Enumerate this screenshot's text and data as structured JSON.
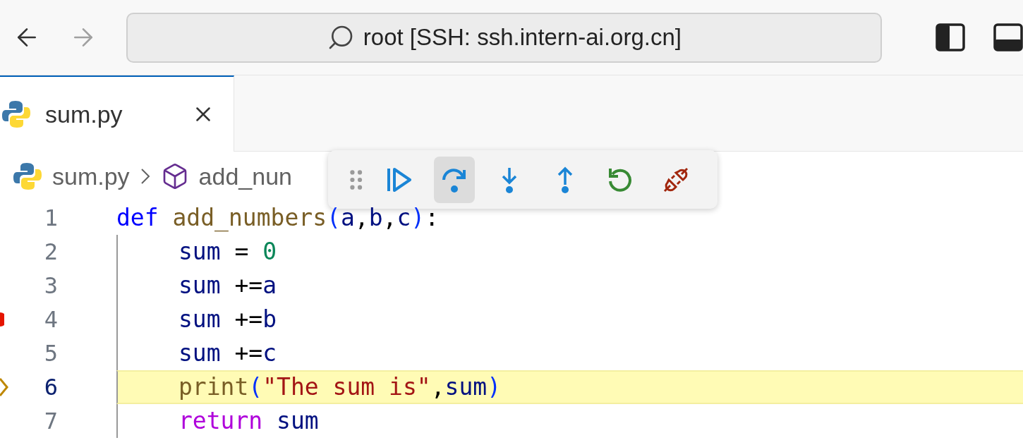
{
  "title_bar": {
    "nav": [
      {
        "kind": "back",
        "disabled": false
      },
      {
        "kind": "forward",
        "disabled": true
      }
    ],
    "command_center": "root [SSH: ssh.intern-ai.org.cn]"
  },
  "tabs": [
    {
      "label": "sum.py",
      "selected": true
    }
  ],
  "breadcrumb": [
    {
      "kind": "file",
      "label": "sum.py"
    },
    {
      "kind": "symbol",
      "label": "add_nun"
    }
  ],
  "debug_toolbar": [
    {
      "kind": "continue",
      "selected": false
    },
    {
      "kind": "step_over",
      "selected": true
    },
    {
      "kind": "step_into",
      "selected": false
    },
    {
      "kind": "step_out",
      "selected": false
    },
    {
      "kind": "restart",
      "selected": false
    },
    {
      "kind": "disconnect",
      "selected": false
    }
  ],
  "code": [
    {
      "number": "1",
      "breakpoint": false,
      "current": false,
      "indented": false,
      "tokens": [
        {
          "kind": "keyword",
          "text": "def "
        },
        {
          "kind": "function",
          "text": "add_numbers"
        },
        {
          "kind": "bracket",
          "text": "("
        },
        {
          "kind": "variable",
          "text": "a"
        },
        {
          "kind": "plain",
          "text": ","
        },
        {
          "kind": "variable",
          "text": "b"
        },
        {
          "kind": "plain",
          "text": ","
        },
        {
          "kind": "variable",
          "text": "c"
        },
        {
          "kind": "bracket",
          "text": ")"
        },
        {
          "kind": "plain",
          "text": ":"
        }
      ]
    },
    {
      "number": "2",
      "breakpoint": false,
      "current": false,
      "indented": true,
      "tokens": [
        {
          "kind": "variable",
          "text": "sum"
        },
        {
          "kind": "plain",
          "text": " = "
        },
        {
          "kind": "number",
          "text": "0"
        }
      ]
    },
    {
      "number": "3",
      "breakpoint": false,
      "current": false,
      "indented": true,
      "tokens": [
        {
          "kind": "variable",
          "text": "sum"
        },
        {
          "kind": "plain",
          "text": " +="
        },
        {
          "kind": "variable",
          "text": "a"
        }
      ]
    },
    {
      "number": "4",
      "breakpoint": true,
      "current": false,
      "indented": true,
      "tokens": [
        {
          "kind": "variable",
          "text": "sum"
        },
        {
          "kind": "plain",
          "text": " +="
        },
        {
          "kind": "variable",
          "text": "b"
        }
      ]
    },
    {
      "number": "5",
      "breakpoint": false,
      "current": false,
      "indented": true,
      "tokens": [
        {
          "kind": "variable",
          "text": "sum"
        },
        {
          "kind": "plain",
          "text": " +="
        },
        {
          "kind": "variable",
          "text": "c"
        }
      ]
    },
    {
      "number": "6",
      "breakpoint": false,
      "current": true,
      "indented": true,
      "tokens": [
        {
          "kind": "function",
          "text": "print"
        },
        {
          "kind": "bracket",
          "text": "("
        },
        {
          "kind": "string",
          "text": "\"The sum is\""
        },
        {
          "kind": "plain",
          "text": ","
        },
        {
          "kind": "variable",
          "text": "sum"
        },
        {
          "kind": "bracket",
          "text": ")"
        }
      ]
    },
    {
      "number": "7",
      "breakpoint": false,
      "current": false,
      "indented": true,
      "tokens": [
        {
          "kind": "control",
          "text": "return "
        },
        {
          "kind": "variable",
          "text": "sum"
        }
      ]
    }
  ]
}
